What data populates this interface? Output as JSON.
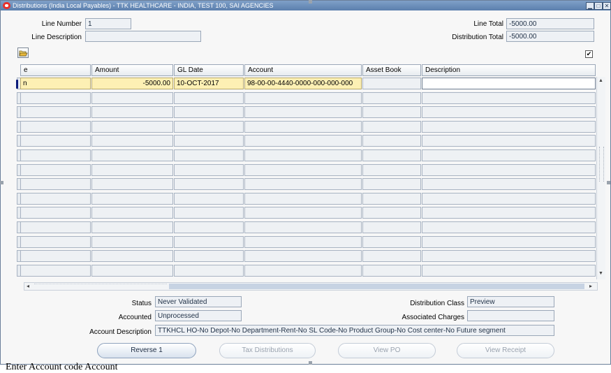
{
  "window": {
    "title": "Distributions (India Local Payables) - TTK HEALTHCARE - INDIA, TEST 100, SAI AGENCIES",
    "controls": [
      "minimize",
      "maximize",
      "close"
    ]
  },
  "header": {
    "line_number_label": "Line Number",
    "line_number_value": "1",
    "line_description_label": "Line Description",
    "line_description_value": "",
    "line_total_label": "Line Total",
    "line_total_value": "-5000.00",
    "distribution_total_label": "Distribution Total",
    "distribution_total_value": "-5000.00"
  },
  "toolbar": {
    "folder_icon": "open-folder-icon",
    "checkbox_checked": true,
    "checkbox_glyph": "✔"
  },
  "table": {
    "columns": [
      "e",
      "Amount",
      "GL Date",
      "Account",
      "Asset Book",
      "Description"
    ],
    "rows": [
      {
        "e": "n",
        "amount": "-5000.00",
        "gl_date": "10-OCT-2017",
        "account": "98-00-00-4440-0000-000-000-000",
        "asset_book": "",
        "description": ""
      },
      {
        "e": "",
        "amount": "",
        "gl_date": "",
        "account": "",
        "asset_book": "",
        "description": ""
      },
      {
        "e": "",
        "amount": "",
        "gl_date": "",
        "account": "",
        "asset_book": "",
        "description": ""
      },
      {
        "e": "",
        "amount": "",
        "gl_date": "",
        "account": "",
        "asset_book": "",
        "description": ""
      },
      {
        "e": "",
        "amount": "",
        "gl_date": "",
        "account": "",
        "asset_book": "",
        "description": ""
      },
      {
        "e": "",
        "amount": "",
        "gl_date": "",
        "account": "",
        "asset_book": "",
        "description": ""
      },
      {
        "e": "",
        "amount": "",
        "gl_date": "",
        "account": "",
        "asset_book": "",
        "description": ""
      },
      {
        "e": "",
        "amount": "",
        "gl_date": "",
        "account": "",
        "asset_book": "",
        "description": ""
      },
      {
        "e": "",
        "amount": "",
        "gl_date": "",
        "account": "",
        "asset_book": "",
        "description": ""
      },
      {
        "e": "",
        "amount": "",
        "gl_date": "",
        "account": "",
        "asset_book": "",
        "description": ""
      },
      {
        "e": "",
        "amount": "",
        "gl_date": "",
        "account": "",
        "asset_book": "",
        "description": ""
      },
      {
        "e": "",
        "amount": "",
        "gl_date": "",
        "account": "",
        "asset_book": "",
        "description": ""
      },
      {
        "e": "",
        "amount": "",
        "gl_date": "",
        "account": "",
        "asset_book": "",
        "description": ""
      },
      {
        "e": "",
        "amount": "",
        "gl_date": "",
        "account": "",
        "asset_book": "",
        "description": ""
      }
    ]
  },
  "details": {
    "status_label": "Status",
    "status_value": "Never Validated",
    "accounted_label": "Accounted",
    "accounted_value": "Unprocessed",
    "account_description_label": "Account Description",
    "account_description_value": "TTKHCL HO-No Depot-No Department-Rent-No SL Code-No Product Group-No Cost center-No Future segment",
    "distribution_class_label": "Distribution Class",
    "distribution_class_value": "Preview",
    "associated_charges_label": "Associated Charges",
    "associated_charges_value": ""
  },
  "buttons": {
    "reverse": "Reverse 1",
    "tax_distributions": "Tax Distributions",
    "view_po": "View PO",
    "view_receipt": "View Receipt"
  },
  "footer_text": "Enter Account code Account",
  "colors": {
    "title_bar": "#5b7fad",
    "active_row": "#fdf0b4",
    "cell_bg": "#eef1f4"
  }
}
